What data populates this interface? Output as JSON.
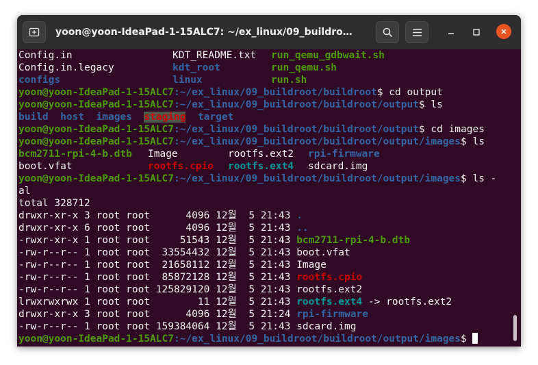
{
  "window": {
    "title": "yoon@yoon-IdeaPad-1-15ALC7: ~/ex_linux/09_buildroot/buil...",
    "icons": {
      "new_tab": "new-tab-icon",
      "search": "search-icon",
      "menu": "hamburger-menu-icon",
      "minimize": "minimize-icon",
      "maximize": "maximize-icon",
      "close": "close-icon"
    },
    "colors": {
      "titlebar": "#2d2d2d",
      "terminal_bg": "#300a24",
      "close": "#e95420"
    }
  },
  "terminal": {
    "prompt_user": "yoon@yoon-IdeaPad-1-15ALC7",
    "listing1": [
      [
        {
          "t": "Config.in",
          "w": 225
        },
        {
          "t": "KDT_README.txt",
          "w": 144
        },
        {
          "t": "run_qemu_gdbwait.sh",
          "c": "exe"
        }
      ],
      [
        {
          "t": "Config.in.legacy",
          "w": 225
        },
        {
          "t": "kdt_root",
          "c": "dir",
          "w": 144
        },
        {
          "t": "run_qemu.sh",
          "c": "exe"
        }
      ],
      [
        {
          "t": "configs",
          "c": "dir",
          "w": 225
        },
        {
          "t": "linux",
          "c": "dir",
          "w": 144
        },
        {
          "t": "run.sh",
          "c": "exe"
        }
      ]
    ],
    "prompt1": {
      "path": ":~/ex_linux/09_buildroot/buildroot",
      "cmd": "$ cd output"
    },
    "prompt2": {
      "path": ":~/ex_linux/09_buildroot/buildroot/output",
      "cmd": "$ ls"
    },
    "listing2": [
      {
        "t": "build",
        "c": "dir"
      },
      {
        "t": "  "
      },
      {
        "t": "host",
        "c": "dir"
      },
      {
        "t": "  "
      },
      {
        "t": "images",
        "c": "dir"
      },
      {
        "t": "  "
      },
      {
        "t": "staging",
        "c": "stg"
      },
      {
        "t": "  "
      },
      {
        "t": "target",
        "c": "dir"
      }
    ],
    "prompt3": {
      "path": ":~/ex_linux/09_buildroot/buildroot/output",
      "cmd": "$ cd images"
    },
    "prompt4": {
      "path": ":~/ex_linux/09_buildroot/buildroot/output/images",
      "cmd": "$ ls"
    },
    "listing3": [
      [
        {
          "t": "bcm2711-rpi-4-b.dtb",
          "c": "exe",
          "w": 189
        },
        {
          "t": "Image",
          "w": 117
        },
        {
          "t": "rootfs.ext2",
          "w": 117
        },
        {
          "t": "rpi-firmware",
          "c": "dir"
        }
      ],
      [
        {
          "t": "boot.vfat",
          "w": 189
        },
        {
          "t": "rootfs.cpio",
          "c": "arc",
          "w": 117
        },
        {
          "t": "rootfs.ext4",
          "c": "lnk",
          "w": 117
        },
        {
          "t": "sdcard.img"
        }
      ]
    ],
    "prompt5": {
      "path": ":~/ex_linux/09_buildroot/buildroot/output/images",
      "cmd": "$ ls -"
    },
    "wrap": "al",
    "total": "total 328712",
    "long_listing": [
      {
        "meta": "drwxr-xr-x 3 root root      4096 12월  5 21:43 ",
        "name": ".",
        "c": "dir"
      },
      {
        "meta": "drwxr-xr-x 6 root root      4096 12월  5 21:43 ",
        "name": "..",
        "c": "dir"
      },
      {
        "meta": "-rwxr-xr-x 1 root root     51543 12월  5 21:43 ",
        "name": "bcm2711-rpi-4-b.dtb",
        "c": "exe"
      },
      {
        "meta": "-rw-r--r-- 1 root root  33554432 12월  5 21:43 ",
        "name": "boot.vfat"
      },
      {
        "meta": "-rw-r--r-- 1 root root  21658112 12월  5 21:43 ",
        "name": "Image"
      },
      {
        "meta": "-rw-r--r-- 1 root root  85872128 12월  5 21:43 ",
        "name": "rootfs.cpio",
        "c": "arc"
      },
      {
        "meta": "-rw-r--r-- 1 root root 125829120 12월  5 21:43 ",
        "name": "rootfs.ext2"
      },
      {
        "meta": "lrwxrwxrwx 1 root root        11 12월  5 21:43 ",
        "name": "rootfs.ext4",
        "c": "lnk",
        "tail": " -> rootfs.ext2"
      },
      {
        "meta": "drwxr-xr-x 3 root root      4096 12월  5 21:24 ",
        "name": "rpi-firmware",
        "c": "dir"
      },
      {
        "meta": "-rw-r--r-- 1 root root 159384064 12월  5 21:43 ",
        "name": "sdcard.img"
      }
    ],
    "prompt6": {
      "path": ":~/ex_linux/09_buildroot/buildroot/output/images",
      "cmd": "$ "
    }
  }
}
